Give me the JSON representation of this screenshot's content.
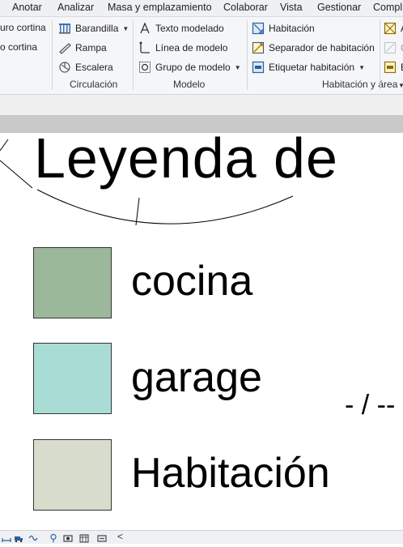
{
  "menubar": {
    "items": [
      "Anotar",
      "Analizar",
      "Masa y emplazamiento",
      "Colaborar",
      "Vista",
      "Gestionar",
      "Compl"
    ]
  },
  "ribbon": {
    "cut_left": [
      "uro cortina",
      "o cortina"
    ],
    "circulacion": {
      "title": "Circulación",
      "barandilla": "Barandilla",
      "rampa": "Rampa",
      "escalera": "Escalera"
    },
    "modelo": {
      "title": "Modelo",
      "texto_modelado": "Texto modelado",
      "linea_de_modelo": "Línea de modelo",
      "grupo_de_modelo": "Grupo de modelo"
    },
    "habitacion_area": {
      "title": "Habitación y área",
      "habitacion": "Habitación",
      "separador": "Separador  de habitación",
      "etiquetar": "Etiquetar  habitación"
    },
    "cut_right": [
      "A",
      "C",
      "E"
    ]
  },
  "drawing": {
    "legend_title": "Leyenda de",
    "entries": [
      {
        "label": "cocina",
        "color": "#9cb89a"
      },
      {
        "label": "garage",
        "color": "#aadcd6"
      },
      {
        "label": "Habitación",
        "color": "#d8dccd"
      }
    ],
    "dimension_text": "- / --"
  },
  "status": {
    "icons": [
      "dimension-icon",
      "truck-icon",
      "link-icon",
      "pin-icon",
      "camera-icon",
      "network-icon",
      "tag-icon",
      "collapse-icon"
    ],
    "collapse_glyph": "<"
  },
  "colors": {
    "menubar_bg": "#eef0f3",
    "ribbon_bg": "#f5f6f8",
    "gray_bar": "#c9c9c9"
  }
}
